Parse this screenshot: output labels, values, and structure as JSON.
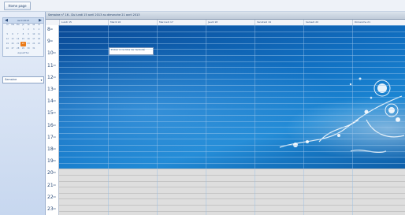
{
  "toolbar": {
    "button_label": "Home page"
  },
  "calendar": {
    "title": "avril 2013",
    "prev": "◀",
    "next": "▶",
    "dows": [
      "lu",
      "ma",
      "me",
      "je",
      "ve",
      "sa",
      "di"
    ],
    "days": [
      "",
      "",
      "",
      "1",
      "2",
      "3",
      "4",
      "5",
      "6",
      "7",
      "8",
      "9",
      "10",
      "11",
      "12",
      "13",
      "14",
      "15",
      "16",
      "17",
      "18",
      "19",
      "20",
      "21",
      "22",
      "23",
      "24",
      "25",
      "26",
      "27",
      "28",
      "29",
      "30",
      "31",
      ""
    ],
    "today": "22",
    "footer": "Aujourd'hui"
  },
  "view_select": {
    "value": "Semaine",
    "arrow": "▾"
  },
  "header": {
    "title": "Semaine n° 16 - Du lundi 15 avril 2013 au dimanche 21 avril 2013"
  },
  "columns": [
    "Lundi 15",
    "Mardi 16",
    "Mercredi 17",
    "Jeudi 18",
    "Vendredi 19",
    "Samedi 20",
    "Dimanche 21"
  ],
  "hours": [
    "8",
    "9",
    "10",
    "11",
    "12",
    "13",
    "14",
    "15",
    "16",
    "17",
    "18",
    "19",
    "20",
    "21",
    "22",
    "23"
  ],
  "hour_suffix": "00",
  "event": {
    "text": "Entrer ici le titre de l'activité"
  },
  "colors": {
    "workday": "#1170c2",
    "off_hours": "#dedede",
    "today": "#ea7a18"
  },
  "icons": {
    "prev": "chevron-left-icon",
    "next": "chevron-right-icon",
    "dropdown": "chevron-down-icon"
  }
}
